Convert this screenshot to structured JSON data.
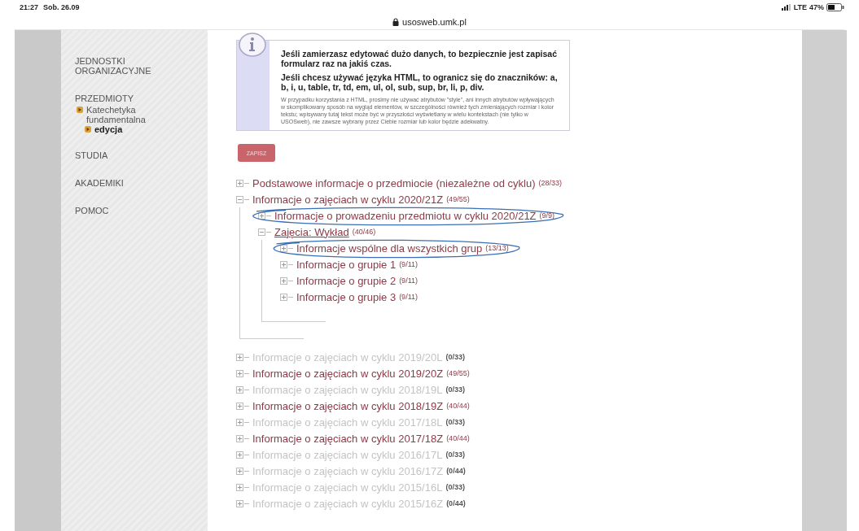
{
  "status_bar": {
    "time": "21:27",
    "date": "Sob. 26.09",
    "network": "LTE",
    "battery": "47%"
  },
  "address_bar": {
    "url": "usosweb.umk.pl"
  },
  "sidebar": {
    "items": [
      {
        "label": "JEDNOSTKI ORGANIZACYJNE",
        "selected": false
      },
      {
        "label": "PRZEDMIOTY",
        "selected": false,
        "children": [
          {
            "label": "Katechetyka fundamentalna",
            "selected": false,
            "children": [
              {
                "label": "edycja",
                "selected": true
              }
            ]
          }
        ]
      },
      {
        "label": "STUDIA",
        "selected": false
      },
      {
        "label": "AKADEMIKI",
        "selected": false
      },
      {
        "label": "POMOC",
        "selected": false
      }
    ]
  },
  "info_box": {
    "paragraphs": [
      {
        "kind": "main",
        "text": "Jeśli zamierzasz edytować dużo danych, to bezpiecznie jest zapisać formularz raz na jakiś czas."
      },
      {
        "kind": "main",
        "text": "Jeśli chcesz używać języka HTML, to ogranicz się do znaczników: a, b, i, u, table, tr, td, em, ul, ol, sub, sup, br, li, p, div."
      },
      {
        "kind": "note",
        "text": "W przypadku korzystania z HTML, prosimy nie używać atrybutów \"style\", ani innych atrybutów wpływających w skomplikowany sposób na wygląd elementów, w szczególności również tych zmieniających rozmiar i kolor tekstu; wpisywany tutaj tekst może być w przyszłości wyświetlany w wielu kontekstach (nie tylko w USOSweb), nie zawsze wybrany przez Ciebie rozmiar lub kolor będzie adekwatny."
      }
    ]
  },
  "save_button": {
    "label": "ZAPISZ"
  },
  "tree": [
    {
      "label": "Podstawowe informacje o przedmiocie (niezależne od cyklu)",
      "count": "(28/33)",
      "empty": false,
      "expanded": false,
      "underlined": false,
      "circled": false
    },
    {
      "label": "Informacje o zajęciach w cyklu 2020/21Z",
      "count": "(49/55)",
      "empty": false,
      "expanded": true,
      "underlined": false,
      "circled": false,
      "children": [
        {
          "label": "Informacje o prowadzeniu przedmiotu w cyklu 2020/21Z",
          "count": "(9/9)",
          "empty": false,
          "expanded": false,
          "underlined": false,
          "circled": true
        },
        {
          "label": "Zajęcia: Wykład",
          "count": "(40/46)",
          "empty": false,
          "expanded": true,
          "underlined": true,
          "circled": false,
          "children": [
            {
              "label": "Informacje wspólne dla wszystkich grup",
              "count": "(13/13)",
              "empty": false,
              "expanded": false,
              "underlined": false,
              "circled": true
            },
            {
              "label": "Informacje o grupie 1",
              "count": "(9/11)",
              "empty": false,
              "expanded": false,
              "underlined": false,
              "circled": false
            },
            {
              "label": "Informacje o grupie 2",
              "count": "(9/11)",
              "empty": false,
              "expanded": false,
              "underlined": false,
              "circled": false
            },
            {
              "label": "Informacje o grupie 3",
              "count": "(9/11)",
              "empty": false,
              "expanded": false,
              "underlined": false,
              "circled": false
            }
          ]
        }
      ]
    },
    {
      "label": "Informacje o zajęciach w cyklu 2019/20L",
      "count": "(0/33)",
      "empty": true,
      "expanded": false,
      "underlined": false,
      "circled": false
    },
    {
      "label": "Informacje o zajęciach w cyklu 2019/20Z",
      "count": "(49/55)",
      "empty": false,
      "expanded": false,
      "underlined": false,
      "circled": false
    },
    {
      "label": "Informacje o zajęciach w cyklu 2018/19L",
      "count": "(0/33)",
      "empty": true,
      "expanded": false,
      "underlined": false,
      "circled": false
    },
    {
      "label": "Informacje o zajęciach w cyklu 2018/19Z",
      "count": "(40/44)",
      "empty": false,
      "expanded": false,
      "underlined": false,
      "circled": false
    },
    {
      "label": "Informacje o zajęciach w cyklu 2017/18L",
      "count": "(0/33)",
      "empty": true,
      "expanded": false,
      "underlined": false,
      "circled": false
    },
    {
      "label": "Informacje o zajęciach w cyklu 2017/18Z",
      "count": "(40/44)",
      "empty": false,
      "expanded": false,
      "underlined": false,
      "circled": false
    },
    {
      "label": "Informacje o zajęciach w cyklu 2016/17L",
      "count": "(0/33)",
      "empty": true,
      "expanded": false,
      "underlined": false,
      "circled": false
    },
    {
      "label": "Informacje o zajęciach w cyklu 2016/17Z",
      "count": "(0/44)",
      "empty": true,
      "expanded": false,
      "underlined": false,
      "circled": false
    },
    {
      "label": "Informacje o zajęciach w cyklu 2015/16L",
      "count": "(0/33)",
      "empty": true,
      "expanded": false,
      "underlined": false,
      "circled": false
    },
    {
      "label": "Informacje o zajęciach w cyklu 2015/16Z",
      "count": "(0/44)",
      "empty": true,
      "expanded": false,
      "underlined": false,
      "circled": false
    }
  ]
}
